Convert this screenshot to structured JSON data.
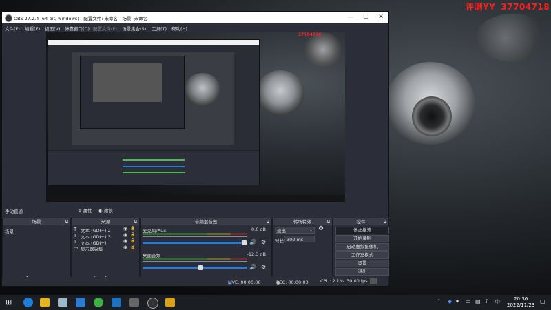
{
  "watermark": {
    "text": "评测YY",
    "number": "37704718"
  },
  "window": {
    "title": "OBS 27.2.4 (64-bit, windows) - 配置文件: 未命名 - 场景: 未命名",
    "minimize": "—",
    "maximize": "☐",
    "close": "✕"
  },
  "menu": [
    "文件(F)",
    "编辑(E)",
    "视图(V)",
    "停靠窗口(D)",
    "配置文件(P)",
    "场景集合(S)",
    "工具(T)",
    "帮助(H)"
  ],
  "transition_bar": {
    "label": "手动直通",
    "properties": "属性",
    "filters": "滤镜"
  },
  "scenes": {
    "header": "场景",
    "items": [
      "场景"
    ]
  },
  "sources": {
    "header": "来源",
    "items": [
      {
        "icon": "text-icon",
        "label": "文本 (GDI+) 2"
      },
      {
        "icon": "text-icon",
        "label": "文本 (GDI+) 3"
      },
      {
        "icon": "text-icon",
        "label": "文本 (GDI+)"
      },
      {
        "icon": "display-icon",
        "label": "显示器采集"
      }
    ]
  },
  "mixer": {
    "header": "音频混音器",
    "channels": [
      {
        "name": "麦克风/Aux",
        "db": "0.0 dB",
        "level": 0.0,
        "volume": 0.97
      },
      {
        "name": "桌面音频",
        "db": "-12.3 dB",
        "level": 0.0,
        "volume": 0.55
      }
    ]
  },
  "transitions": {
    "header": "转场特效",
    "type": "淡出",
    "duration_label": "时长",
    "duration_value": "300 ms"
  },
  "controls": {
    "header": "控件",
    "buttons": [
      "停止推流",
      "开始录制",
      "启动虚拟摄像机",
      "工作室模式",
      "设置",
      "退出"
    ]
  },
  "status": {
    "live": "LIVE: 00:00:06",
    "rec": "REC: 00:00:00",
    "cpu": "CPU: 2.1%, 30.00 fps"
  },
  "taskbar": {
    "time": "20:36",
    "date": "2022/11/23"
  },
  "colors": {
    "accent": "#2a7bd1",
    "watermark": "#ff1f1f",
    "obs_bg": "#2b2e38"
  }
}
